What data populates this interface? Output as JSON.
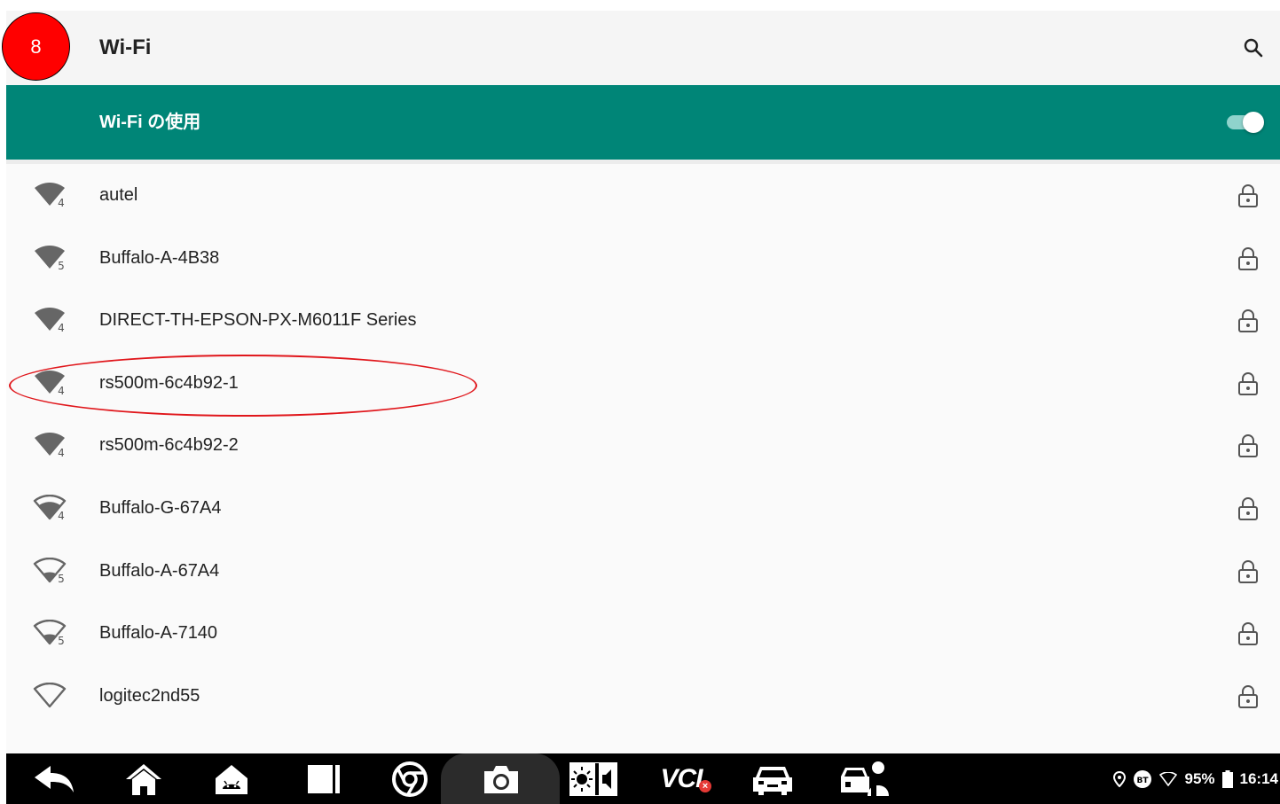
{
  "annotation": {
    "step_number": "8"
  },
  "appbar": {
    "title": "Wi-Fi",
    "search_icon": "search-icon"
  },
  "master_switch": {
    "label": "Wi-Fi の使用",
    "state": "on",
    "accent_color": "#008577"
  },
  "networks": [
    {
      "ssid": "autel",
      "signal": "full",
      "band": "4",
      "secured": true
    },
    {
      "ssid": "Buffalo-A-4B38",
      "signal": "full",
      "band": "5",
      "secured": true
    },
    {
      "ssid": "DIRECT-TH-EPSON-PX-M6011F Series",
      "signal": "full",
      "band": "4",
      "secured": true
    },
    {
      "ssid": "rs500m-6c4b92-1",
      "signal": "full",
      "band": "4",
      "secured": true,
      "highlighted": true
    },
    {
      "ssid": "rs500m-6c4b92-2",
      "signal": "full",
      "band": "4",
      "secured": true
    },
    {
      "ssid": "Buffalo-G-67A4",
      "signal": "high",
      "band": "4",
      "secured": true
    },
    {
      "ssid": "Buffalo-A-67A4",
      "signal": "low",
      "band": "5",
      "secured": true
    },
    {
      "ssid": "Buffalo-A-7140",
      "signal": "low",
      "band": "5",
      "secured": true
    },
    {
      "ssid": "logitec2nd55",
      "signal": "none",
      "band": "",
      "secured": true
    }
  ],
  "taskbar": {
    "buttons": [
      "back-icon",
      "home-icon",
      "android-home-icon",
      "recent-apps-icon",
      "browser-icon",
      "camera-icon",
      "brightness-volume-icon",
      "vci-icon",
      "vehicle-icon",
      "remote-expert-icon"
    ],
    "vci_label": "VCI",
    "status": {
      "battery": "95%",
      "time": "16:14"
    }
  }
}
